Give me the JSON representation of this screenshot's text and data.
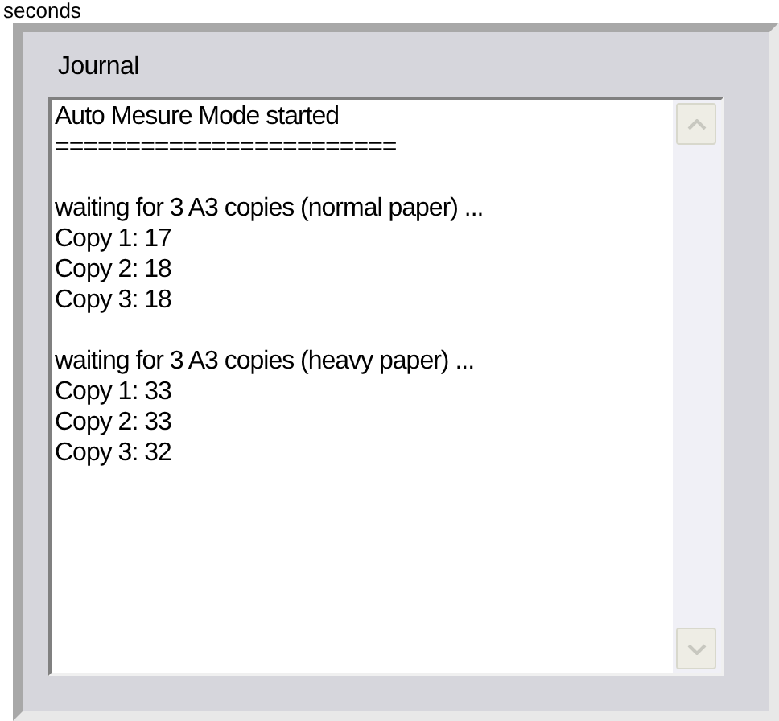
{
  "top_text": "seconds",
  "group": {
    "title": "Journal",
    "log_blocks": [
      [
        "Auto Mesure Mode started",
        "========================"
      ],
      [
        "waiting for 3 A3 copies (normal paper) ...",
        "Copy 1: 17",
        "Copy 2: 18",
        "Copy 3: 18"
      ],
      [
        "waiting for 3 A3 copies (heavy paper) ...",
        "Copy 1: 33",
        "Copy 2: 33",
        "Copy 3: 32"
      ]
    ]
  }
}
